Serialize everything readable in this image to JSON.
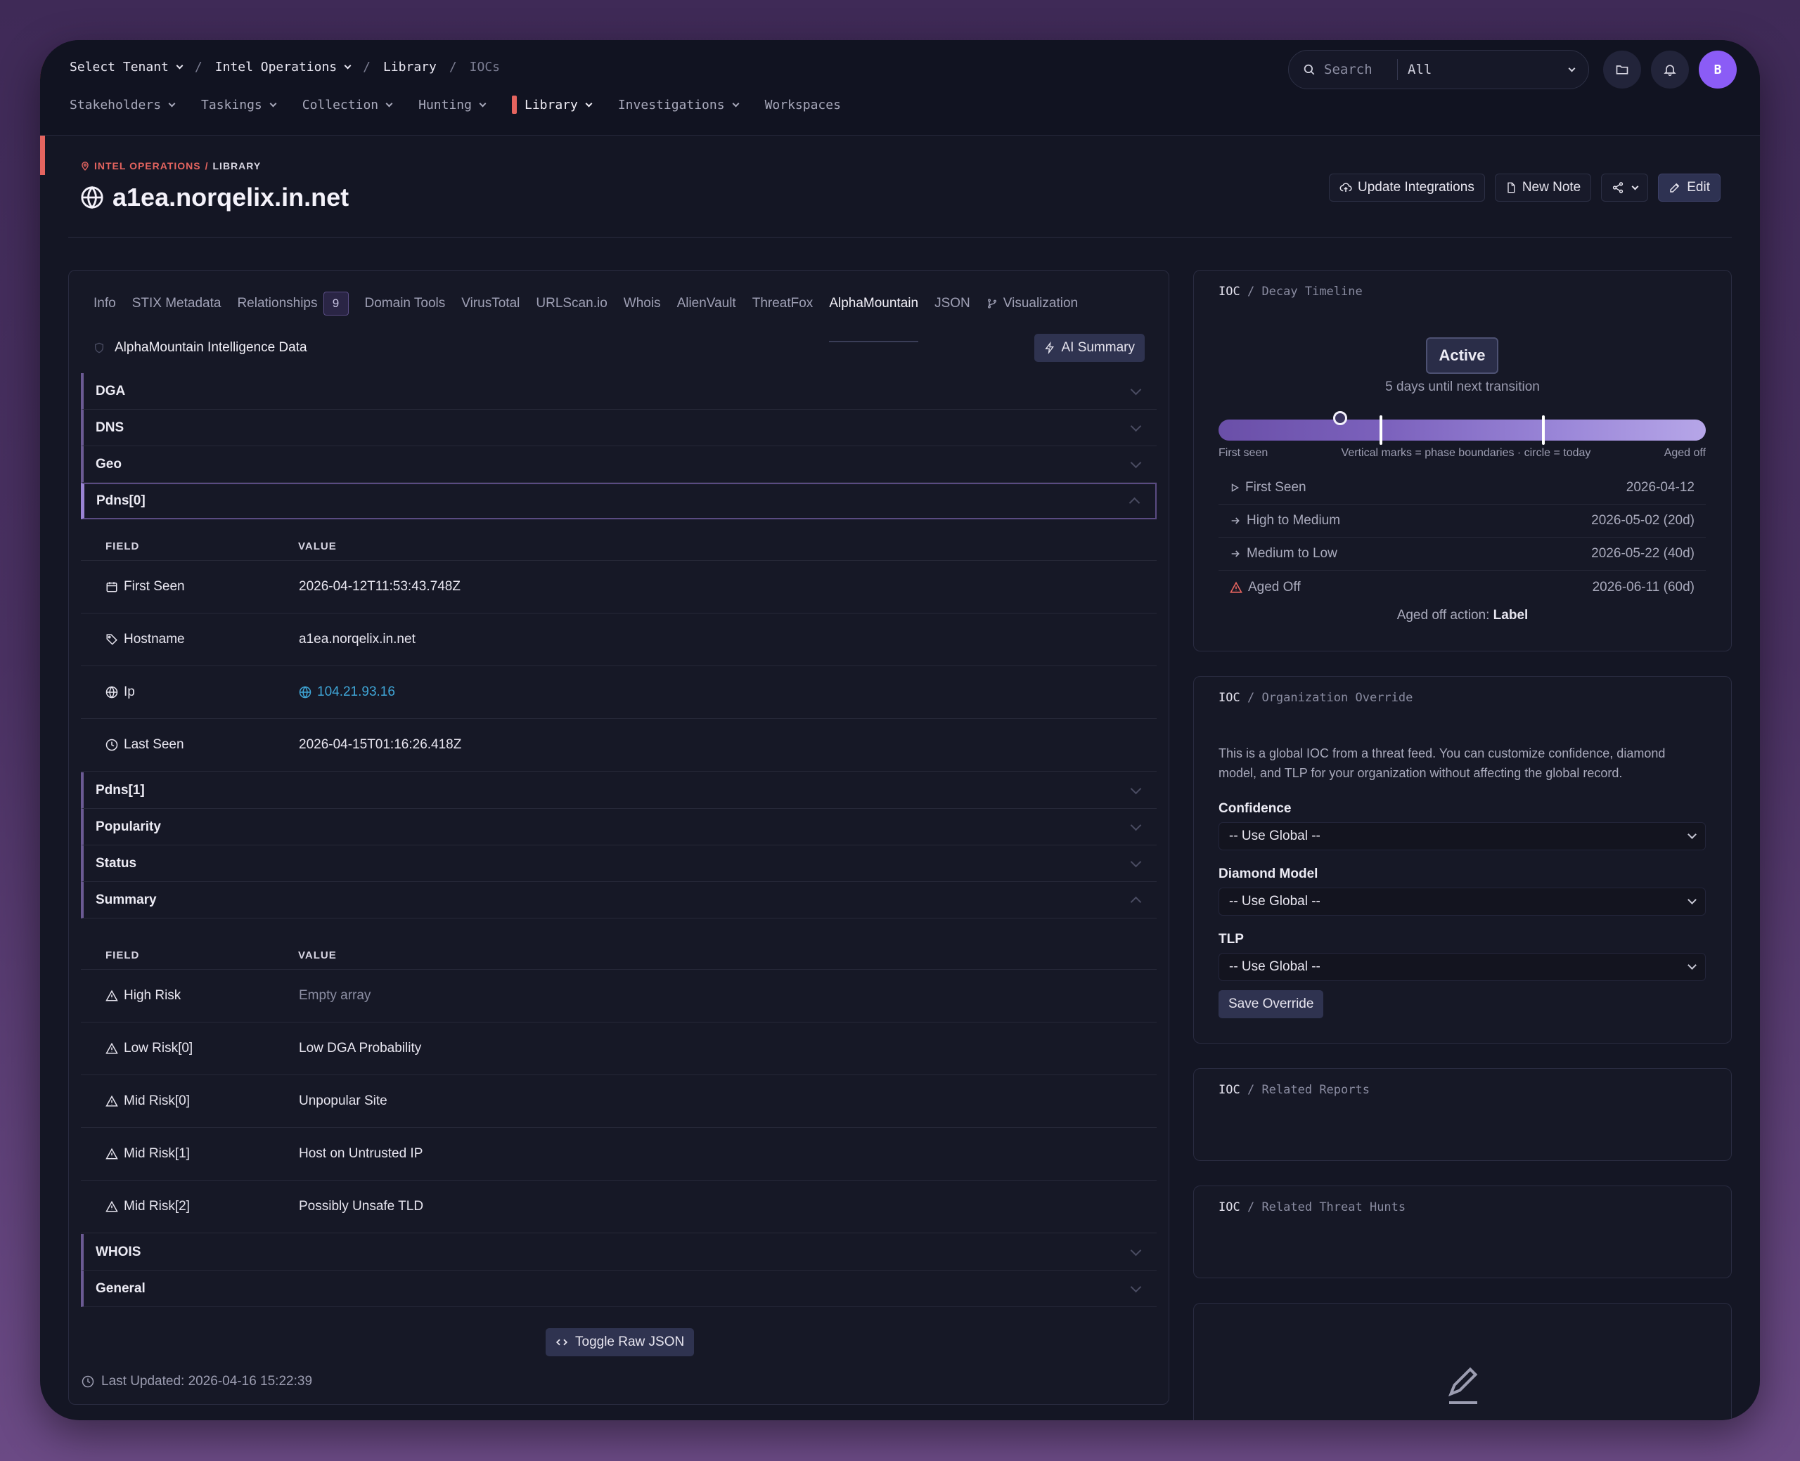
{
  "topbar": {
    "breadcrumb": {
      "tenant": "Select Tenant",
      "section": "Intel Operations",
      "page": "Library",
      "current": "IOCs"
    },
    "nav": [
      "Stakeholders",
      "Taskings",
      "Collection",
      "Hunting",
      "Library",
      "Investigations",
      "Workspaces"
    ],
    "active_nav": "Library",
    "search": {
      "placeholder": "Search",
      "scope": "All"
    },
    "avatar_initial": "B"
  },
  "header": {
    "subtitle_section": "INTEL OPERATIONS",
    "subtitle_sep": "/",
    "subtitle_page": "LIBRARY",
    "title": "a1ea.norqelix.in.net",
    "actions": {
      "update": "Update Integrations",
      "note": "New Note",
      "edit": "Edit"
    }
  },
  "main": {
    "tabs": [
      {
        "label": "Info"
      },
      {
        "label": "STIX Metadata"
      },
      {
        "label": "Relationships",
        "badge": "9"
      },
      {
        "label": "Domain Tools"
      },
      {
        "label": "VirusTotal"
      },
      {
        "label": "URLScan.io"
      },
      {
        "label": "Whois"
      },
      {
        "label": "AlienVault"
      },
      {
        "label": "ThreatFox"
      },
      {
        "label": "AlphaMountain"
      },
      {
        "label": "JSON"
      },
      {
        "label": "Visualization"
      }
    ],
    "active_tab": "AlphaMountain",
    "section_title": "AlphaMountain Intelligence Data",
    "ai_summary": "AI Summary",
    "groups": {
      "dga": "DGA",
      "dns": "DNS",
      "geo": "Geo",
      "pdns0": "Pdns[0]",
      "pdns1": "Pdns[1]",
      "popularity": "Popularity",
      "status": "Status",
      "summary": "Summary",
      "whois": "WHOIS",
      "general": "General"
    },
    "table_head": {
      "field": "FIELD",
      "value": "VALUE"
    },
    "pdns0_rows": [
      {
        "field": "First Seen",
        "value": "2026-04-12T11:53:43.748Z"
      },
      {
        "field": "Hostname",
        "value": "a1ea.norqelix.in.net"
      },
      {
        "field": "Ip",
        "value": "104.21.93.16"
      },
      {
        "field": "Last Seen",
        "value": "2026-04-15T01:16:26.418Z"
      }
    ],
    "summary_rows": [
      {
        "field": "High Risk",
        "value": "Empty array"
      },
      {
        "field": "Low Risk[0]",
        "value": "Low DGA Probability"
      },
      {
        "field": "Mid Risk[0]",
        "value": "Unpopular Site"
      },
      {
        "field": "Mid Risk[1]",
        "value": "Host on Untrusted IP"
      },
      {
        "field": "Mid Risk[2]",
        "value": "Possibly Unsafe TLD"
      }
    ],
    "toggle_json": "Toggle Raw JSON",
    "last_updated": "Last Updated: 2026-04-16 15:22:39"
  },
  "decay": {
    "title_prefix": "IOC",
    "title": "Decay Timeline",
    "status": "Active",
    "note": "5 days until next transition",
    "timeline_fraction": {
      "today": 0.25,
      "boundary_1": 0.333,
      "boundary_2": 0.667
    },
    "label_start": "First seen",
    "label_middle": "Vertical marks = phase boundaries · circle = today",
    "label_end": "Aged off",
    "rows": [
      {
        "label": "First Seen",
        "value": "2026-04-12"
      },
      {
        "label": "High to Medium",
        "value": "2026-05-02 (20d)"
      },
      {
        "label": "Medium to Low",
        "value": "2026-05-22 (40d)"
      },
      {
        "label": "Aged Off",
        "value": "2026-06-11 (60d)"
      }
    ],
    "aged_action_label": "Aged off action:",
    "aged_action_value": "Label"
  },
  "override": {
    "title_prefix": "IOC",
    "title": "Organization Override",
    "description": "This is a global IOC from a threat feed. You can customize confidence, diamond model, and TLP for your organization without affecting the global record.",
    "confidence_label": "Confidence",
    "confidence_value": "-- Use Global --",
    "diamond_label": "Diamond Model",
    "diamond_value": "-- Use Global --",
    "tlp_label": "TLP",
    "tlp_value": "-- Use Global --",
    "save": "Save Override"
  },
  "related_reports": {
    "title_prefix": "IOC",
    "title": "Related Reports"
  },
  "related_hunts": {
    "title_prefix": "IOC",
    "title": "Related Threat Hunts"
  },
  "colors": {
    "accent": "#e5645f",
    "purple": "#8b5cf6",
    "link": "#3fa5d6"
  }
}
